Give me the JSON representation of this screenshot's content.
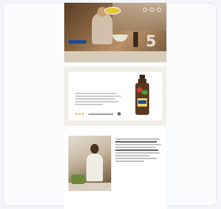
{
  "colors": {
    "brand_blue": "#1e4a8f",
    "brand_yellow": "#e8c63a",
    "band_bg": "#f2eee8"
  },
  "icons": [
    "logo-icon",
    "search-icon",
    "account-icon",
    "cart-icon",
    "product-bottle-icon"
  ]
}
